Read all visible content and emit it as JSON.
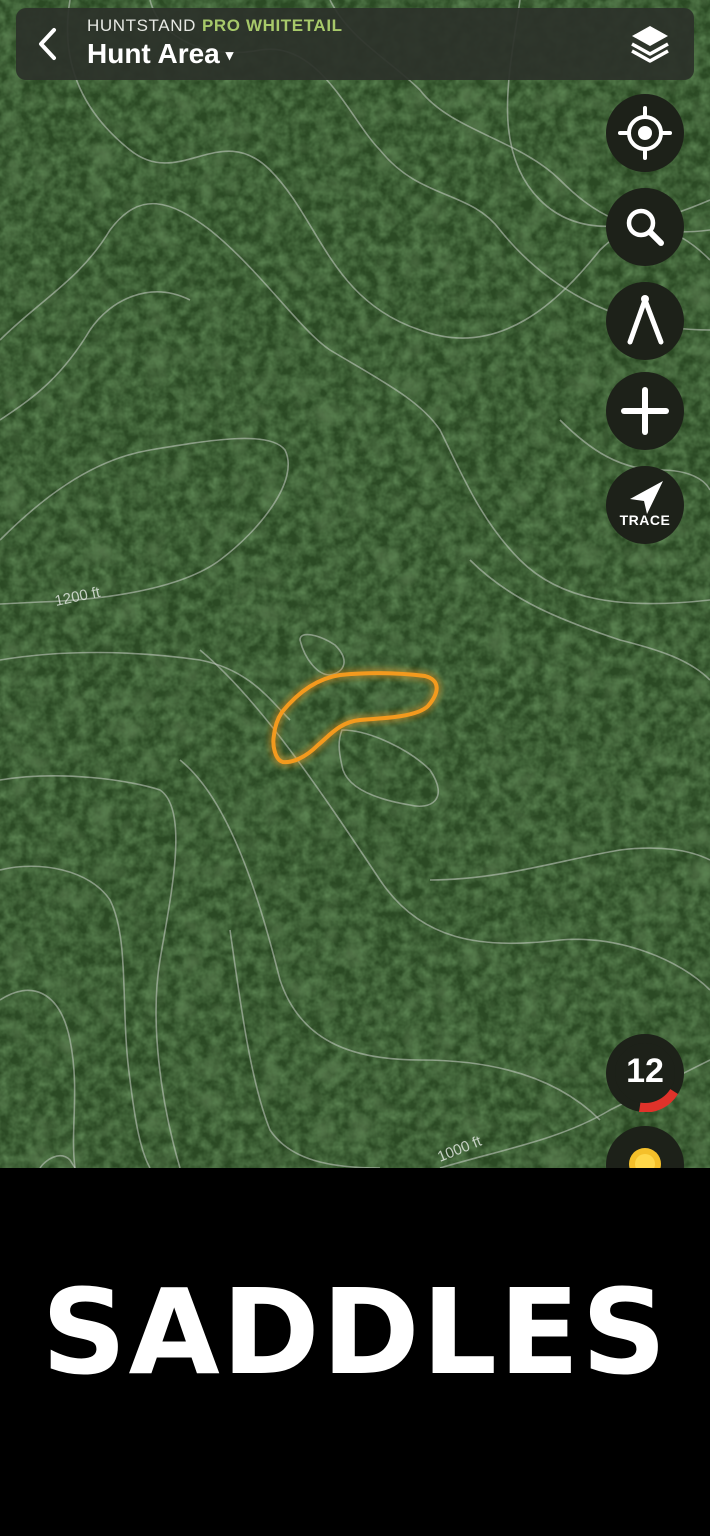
{
  "header": {
    "brand": "HUNTSTAND",
    "brand_tier": "PRO WHITETAIL",
    "title": "Hunt Area",
    "title_caret": "▾",
    "back_icon": "chevron-left-icon",
    "layers_icon": "layers-icon"
  },
  "map": {
    "contour_labels": [
      "1200 ft",
      "1000 ft"
    ],
    "highlight_color": "#f39a1e",
    "contour_color": "#c9cec6"
  },
  "rail": {
    "buttons": [
      {
        "name": "locate",
        "icon": "crosshair-icon"
      },
      {
        "name": "search",
        "icon": "search-icon"
      },
      {
        "name": "measure",
        "icon": "compass-divider-icon"
      },
      {
        "name": "add",
        "icon": "plus-icon"
      },
      {
        "name": "trace",
        "icon": "navigation-arrow-icon",
        "label": "TRACE"
      }
    ],
    "wind": {
      "value": "12",
      "indicator_color": "#e0322a"
    },
    "weather": {
      "icon": "sun-icon"
    }
  },
  "banner": {
    "text": "SADDLES"
  }
}
